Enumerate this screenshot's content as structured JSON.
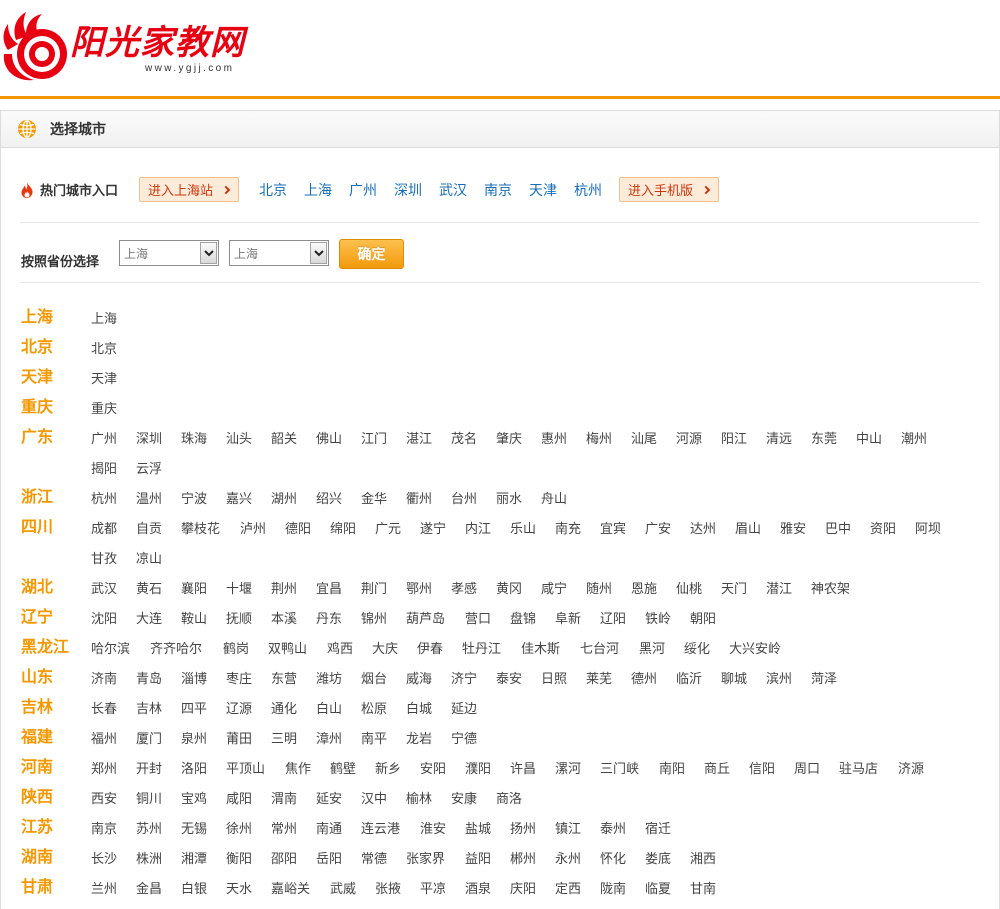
{
  "colors": {
    "accent_orange": "#f39800",
    "logo_red": "#e60012",
    "link_blue": "#1a6db5",
    "button_text": "#c8380e",
    "button_fill": "#fdebd9",
    "button_border": "#f3c08f",
    "city_text": "#444444"
  },
  "site": {
    "logo_icon": "red-swirl-logo-icon",
    "logo_text": "阳光家教网",
    "logo_url_text": "www.ygjj.com"
  },
  "panel": {
    "icon": "globe-icon",
    "title": "选择城市"
  },
  "hot": {
    "icon": "fire-icon",
    "label": "热门城市入口",
    "enter_station_button": "进入上海站",
    "cities": [
      "北京",
      "上海",
      "广州",
      "深圳",
      "武汉",
      "南京",
      "天津",
      "杭州"
    ],
    "mobile_button": "进入手机版",
    "button_icon": "chevron-right-icon"
  },
  "province_select": {
    "label": "按照省份选择",
    "province_value": "上海",
    "city_value": "上海",
    "dropdown_icon": "chevron-down-icon",
    "confirm_button": "确定"
  },
  "provinces": [
    {
      "name": "上海",
      "cities": [
        "上海"
      ]
    },
    {
      "name": "北京",
      "cities": [
        "北京"
      ]
    },
    {
      "name": "天津",
      "cities": [
        "天津"
      ]
    },
    {
      "name": "重庆",
      "cities": [
        "重庆"
      ]
    },
    {
      "name": "广东",
      "cities": [
        "广州",
        "深圳",
        "珠海",
        "汕头",
        "韶关",
        "佛山",
        "江门",
        "湛江",
        "茂名",
        "肇庆",
        "惠州",
        "梅州",
        "汕尾",
        "河源",
        "阳江",
        "清远",
        "东莞",
        "中山",
        "潮州",
        "揭阳",
        "云浮"
      ]
    },
    {
      "name": "浙江",
      "cities": [
        "杭州",
        "温州",
        "宁波",
        "嘉兴",
        "湖州",
        "绍兴",
        "金华",
        "衢州",
        "台州",
        "丽水",
        "舟山"
      ]
    },
    {
      "name": "四川",
      "cities": [
        "成都",
        "自贡",
        "攀枝花",
        "泸州",
        "德阳",
        "绵阳",
        "广元",
        "遂宁",
        "内江",
        "乐山",
        "南充",
        "宜宾",
        "广安",
        "达州",
        "眉山",
        "雅安",
        "巴中",
        "资阳",
        "阿坝",
        "甘孜",
        "凉山"
      ]
    },
    {
      "name": "湖北",
      "cities": [
        "武汉",
        "黄石",
        "襄阳",
        "十堰",
        "荆州",
        "宜昌",
        "荆门",
        "鄂州",
        "孝感",
        "黄冈",
        "咸宁",
        "随州",
        "恩施",
        "仙桃",
        "天门",
        "潜江",
        "神农架"
      ]
    },
    {
      "name": "辽宁",
      "cities": [
        "沈阳",
        "大连",
        "鞍山",
        "抚顺",
        "本溪",
        "丹东",
        "锦州",
        "葫芦岛",
        "营口",
        "盘锦",
        "阜新",
        "辽阳",
        "铁岭",
        "朝阳"
      ]
    },
    {
      "name": "黑龙江",
      "cities": [
        "哈尔滨",
        "齐齐哈尔",
        "鹤岗",
        "双鸭山",
        "鸡西",
        "大庆",
        "伊春",
        "牡丹江",
        "佳木斯",
        "七台河",
        "黑河",
        "绥化",
        "大兴安岭"
      ]
    },
    {
      "name": "山东",
      "cities": [
        "济南",
        "青岛",
        "淄博",
        "枣庄",
        "东营",
        "潍坊",
        "烟台",
        "威海",
        "济宁",
        "泰安",
        "日照",
        "莱芜",
        "德州",
        "临沂",
        "聊城",
        "滨州",
        "菏泽"
      ]
    },
    {
      "name": "吉林",
      "cities": [
        "长春",
        "吉林",
        "四平",
        "辽源",
        "通化",
        "白山",
        "松原",
        "白城",
        "延边"
      ]
    },
    {
      "name": "福建",
      "cities": [
        "福州",
        "厦门",
        "泉州",
        "莆田",
        "三明",
        "漳州",
        "南平",
        "龙岩",
        "宁德"
      ]
    },
    {
      "name": "河南",
      "cities": [
        "郑州",
        "开封",
        "洛阳",
        "平顶山",
        "焦作",
        "鹤壁",
        "新乡",
        "安阳",
        "濮阳",
        "许昌",
        "漯河",
        "三门峡",
        "南阳",
        "商丘",
        "信阳",
        "周口",
        "驻马店",
        "济源"
      ]
    },
    {
      "name": "陕西",
      "cities": [
        "西安",
        "铜川",
        "宝鸡",
        "咸阳",
        "渭南",
        "延安",
        "汉中",
        "榆林",
        "安康",
        "商洛"
      ]
    },
    {
      "name": "江苏",
      "cities": [
        "南京",
        "苏州",
        "无锡",
        "徐州",
        "常州",
        "南通",
        "连云港",
        "淮安",
        "盐城",
        "扬州",
        "镇江",
        "泰州",
        "宿迁"
      ]
    },
    {
      "name": "湖南",
      "cities": [
        "长沙",
        "株洲",
        "湘潭",
        "衡阳",
        "邵阳",
        "岳阳",
        "常德",
        "张家界",
        "益阳",
        "郴州",
        "永州",
        "怀化",
        "娄底",
        "湘西"
      ]
    },
    {
      "name": "甘肃",
      "cities": [
        "兰州",
        "金昌",
        "白银",
        "天水",
        "嘉峪关",
        "武威",
        "张掖",
        "平凉",
        "酒泉",
        "庆阳",
        "定西",
        "陇南",
        "临夏",
        "甘南"
      ]
    }
  ]
}
